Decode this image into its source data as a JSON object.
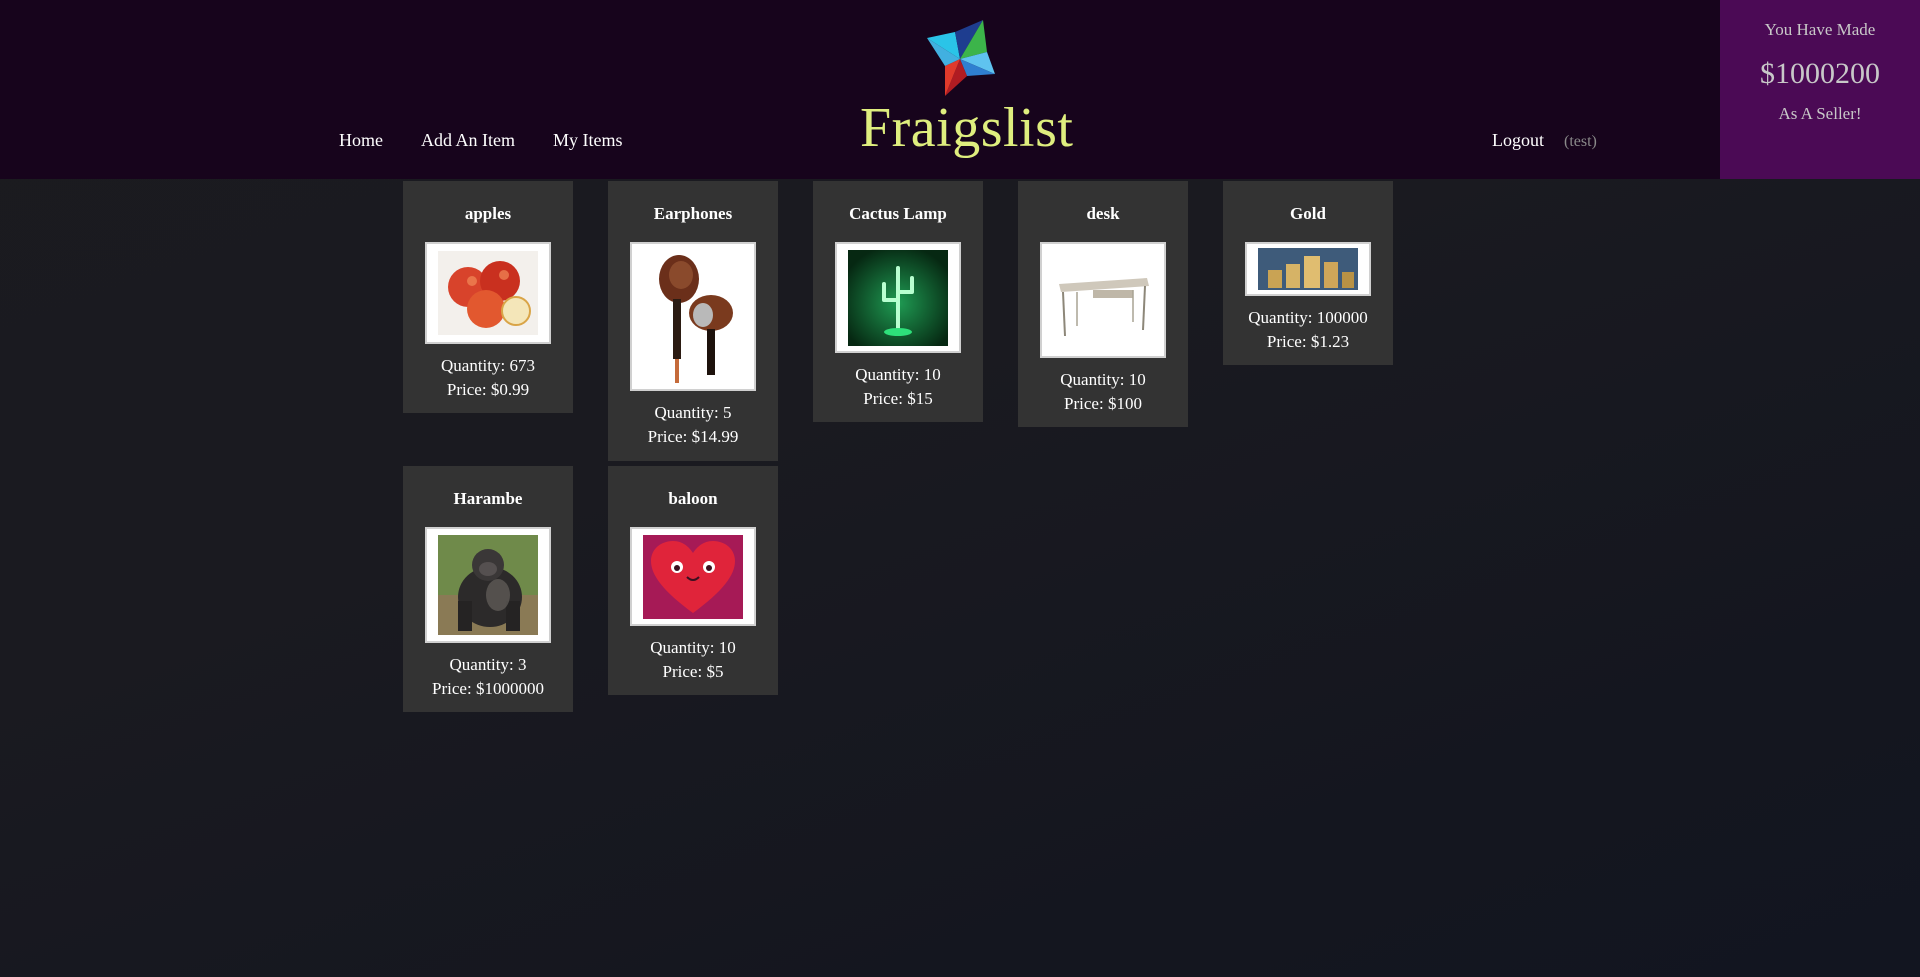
{
  "header": {
    "nav": {
      "home": "Home",
      "add_item": "Add An Item",
      "my_items": "My Items"
    },
    "logo_text": "Fraigslist",
    "logout": "Logout",
    "username": "(test)"
  },
  "earnings": {
    "line1": "You Have Made",
    "amount": "$1000200",
    "line3": "As A Seller!"
  },
  "items": [
    {
      "name": "apples",
      "quantity": "Quantity: 673",
      "price": "Price: $0.99",
      "icon": "apples-image"
    },
    {
      "name": "Earphones",
      "quantity": "Quantity: 5",
      "price": "Price: $14.99",
      "icon": "earphones-image"
    },
    {
      "name": "Cactus Lamp",
      "quantity": "Quantity: 10",
      "price": "Price: $15",
      "icon": "cactus-lamp-image"
    },
    {
      "name": "desk",
      "quantity": "Quantity: 10",
      "price": "Price: $100",
      "icon": "desk-image"
    },
    {
      "name": "Gold",
      "quantity": "Quantity: 100000",
      "price": "Price: $1.23",
      "icon": "gold-coins-image"
    },
    {
      "name": "Harambe",
      "quantity": "Quantity: 3",
      "price": "Price: $1000000",
      "icon": "gorilla-image"
    },
    {
      "name": "baloon",
      "quantity": "Quantity: 10",
      "price": "Price: $5",
      "icon": "heart-balloon-image"
    }
  ],
  "colors": {
    "header_bg": "#17041c",
    "earnings_bg": "#4b0a55",
    "logo_text": "#dfee7e",
    "card_bg": "#333333"
  }
}
